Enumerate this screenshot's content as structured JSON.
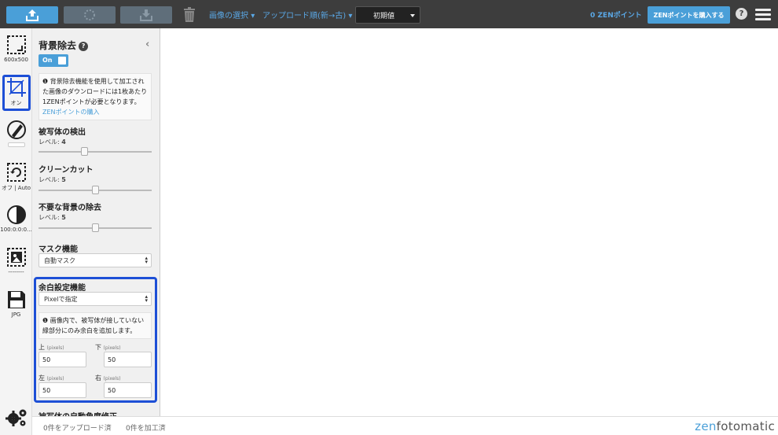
{
  "topbar": {
    "select_images": "画像の選択",
    "sort_order": "アップロード順(新→古)",
    "preset_value": "初期値",
    "points": "0 ZENポイント",
    "buy_points": "ZENポイントを購入する",
    "help": "?"
  },
  "tools": [
    {
      "icon": "resize-icon",
      "label": "600x500"
    },
    {
      "icon": "crop-icon",
      "label": "オン"
    },
    {
      "icon": "brush-icon",
      "label": ""
    },
    {
      "icon": "rotate-icon",
      "label": "オフ | Auto"
    },
    {
      "icon": "contrast-icon",
      "label": "100:0:0:0..."
    },
    {
      "icon": "background-image-icon",
      "label": "--------"
    },
    {
      "icon": "save-icon",
      "label": "JPG"
    },
    {
      "icon": "gears-icon",
      "label": ""
    }
  ],
  "panel": {
    "title": "背景除去",
    "toggle_label": "On",
    "info_text": "背景除去機能を使用して加工された画像のダウンロードには1枚あたり1ZENポイントが必要となります。",
    "info_link": "ZENポイントの購入",
    "subject_detection": {
      "title": "被写体の検出",
      "level_label": "レベル:",
      "level": "4",
      "value": 4,
      "max": 10
    },
    "clean_cut": {
      "title": "クリーンカット",
      "level_label": "レベル:",
      "level": "5",
      "value": 5,
      "max": 10
    },
    "remove_bg": {
      "title": "不要な背景の除去",
      "level_label": "レベル:",
      "level": "5",
      "value": 5,
      "max": 10
    },
    "mask": {
      "title": "マスク機能",
      "selected": "自動マスク"
    },
    "margin": {
      "title": "余白設定機能",
      "mode": "Pixelで指定",
      "note": "画像内で、被写体が接していない縁部分にのみ余白を追加します。",
      "unit": "(pixels)",
      "top_label": "上",
      "top_value": "50",
      "bottom_label": "下",
      "bottom_value": "50",
      "left_label": "左",
      "left_value": "50",
      "right_label": "右",
      "right_value": "50"
    },
    "next_section": "被写体の自動角度修正"
  },
  "status": {
    "uploaded": "0件をアップロード済",
    "processed": "0件を加工済"
  },
  "logo": {
    "part1": "zen",
    "part2": "fotomatic"
  }
}
